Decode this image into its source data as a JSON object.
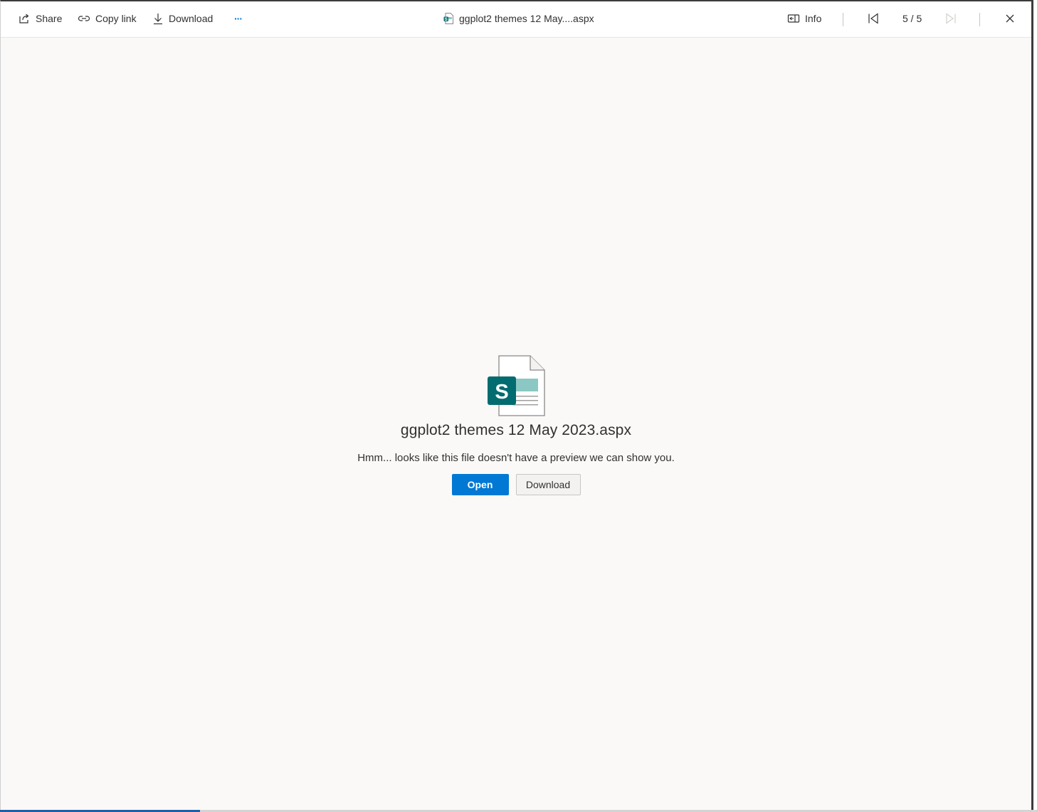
{
  "toolbar": {
    "share_label": "Share",
    "copy_link_label": "Copy link",
    "download_label": "Download",
    "more_label": "···",
    "document_title": "ggplot2 themes 12 May....aspx",
    "info_label": "Info",
    "page_indicator": "5 / 5"
  },
  "preview": {
    "file_name": "ggplot2 themes 12 May 2023.aspx",
    "message": "Hmm... looks like this file doesn't have a preview we can show you.",
    "open_label": "Open",
    "download_label": "Download",
    "file_icon_letter": "S"
  },
  "colors": {
    "accent": "#0078d4",
    "sharepoint_teal": "#036c70",
    "sharepoint_light": "#8bc8c4"
  }
}
